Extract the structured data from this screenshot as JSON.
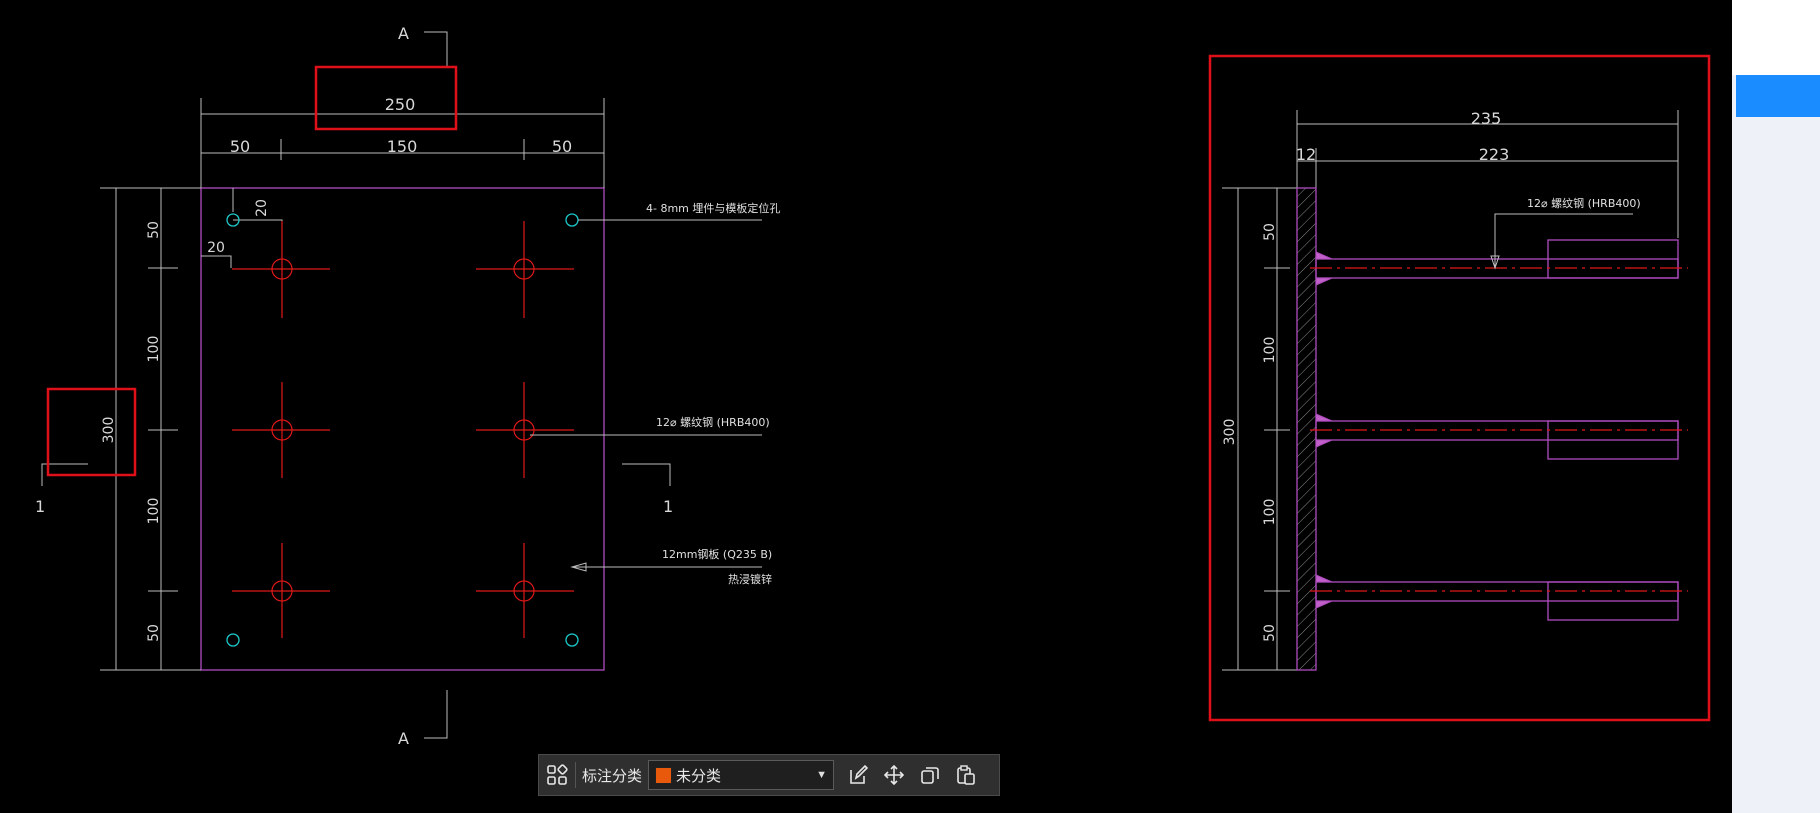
{
  "drawing": {
    "plan": {
      "dims_top": [
        "250",
        "50",
        "150",
        "50"
      ],
      "dims_left": [
        "50",
        "100",
        "100",
        "50"
      ],
      "dim_overall_left": "300",
      "dims_hole_offset": [
        "20",
        "20"
      ],
      "section_marks": [
        "A",
        "A",
        "1",
        "1"
      ],
      "notes": {
        "holes": "4- 8mm 埋件与模板定位孔",
        "rebar": "12⌀ 螺纹钢 (HRB400)",
        "plate_line1": "12mm钢板 (Q235 B)",
        "plate_line2": "热浸镀锌"
      }
    },
    "section": {
      "dims_top": [
        "235",
        "12",
        "223"
      ],
      "dims_left": [
        "50",
        "100",
        "100",
        "50"
      ],
      "dim_overall_left": "300",
      "note_rebar": "12⌀ 螺纹钢 (HRB400)"
    }
  },
  "toolbar": {
    "grid_icon": "grid-icon",
    "label": "标注分类",
    "select_value": "未分类",
    "select_color": "#e8590c",
    "edit_icon": "edit-icon",
    "move_icon": "move-icon",
    "copy_icon": "copy-icon",
    "paste_icon": "paste-icon"
  },
  "colors": {
    "background": "#000000",
    "highlight_box": "#e0101a",
    "plate_outline": "#b04cc0",
    "rebar": "#e01818",
    "positioning_hole": "#1ec8c8",
    "side_tab": "#1a8cff"
  }
}
